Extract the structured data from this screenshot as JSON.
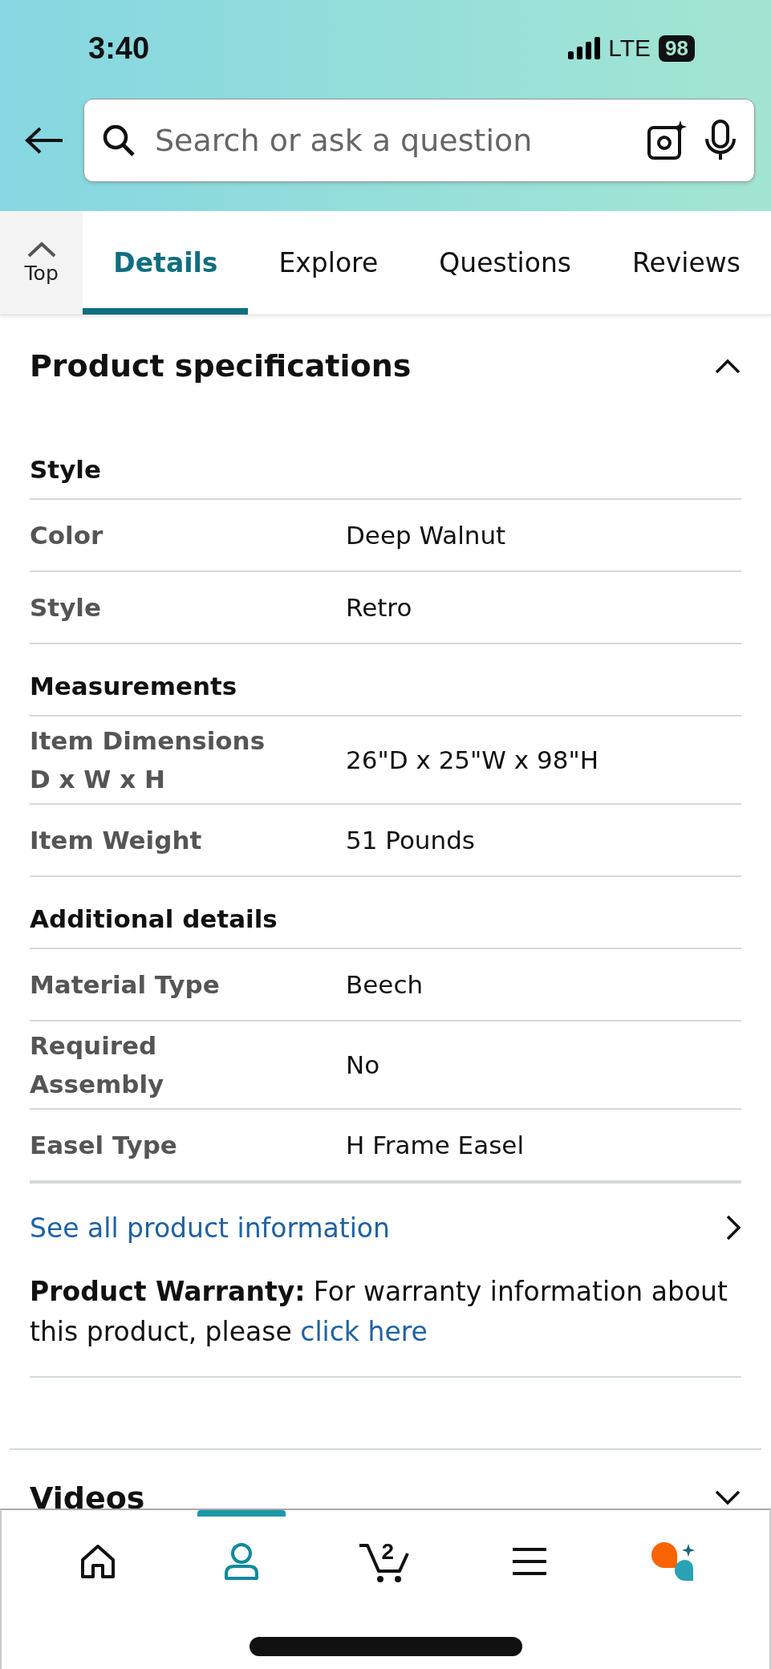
{
  "status_bar": {
    "time": "3:40",
    "network": "LTE",
    "battery": "98"
  },
  "search": {
    "placeholder": "Search or ask a question"
  },
  "tabs": [
    {
      "kind": "top",
      "label": "Top",
      "selected": false
    },
    {
      "kind": "tab",
      "label": "Details",
      "selected": true
    },
    {
      "kind": "tab",
      "label": "Explore",
      "selected": false
    },
    {
      "kind": "tab",
      "label": "Questions",
      "selected": false
    },
    {
      "kind": "tab",
      "label": "Reviews",
      "selected": false
    }
  ],
  "specifications": {
    "title": "Product specifications",
    "expanded": true,
    "groups": [
      {
        "heading": "Style",
        "rows": [
          {
            "label": "Color",
            "value": "Deep Walnut"
          },
          {
            "label": "Style",
            "value": "Retro"
          }
        ]
      },
      {
        "heading": "Measurements",
        "rows": [
          {
            "label": "Item Dimensions D x W x H",
            "value": "26\"D x 25\"W x 98\"H"
          },
          {
            "label": "Item Weight",
            "value": "51 Pounds"
          }
        ]
      },
      {
        "heading": "Additional details",
        "rows": [
          {
            "label": "Material Type",
            "value": "Beech"
          },
          {
            "label": "Required Assembly",
            "value": "No"
          },
          {
            "label": "Easel Type",
            "value": "H Frame Easel"
          }
        ]
      }
    ],
    "see_all_link": "See all product information",
    "warranty": {
      "text": "**Product Warranty:** For warranty information about this product, please ",
      "link": "click here"
    }
  },
  "videos": {
    "title": "Videos",
    "expanded": false
  },
  "bottom_nav": [
    {
      "kind": "home",
      "selected": false
    },
    {
      "kind": "account",
      "selected": true
    },
    {
      "kind": "cart",
      "count": "2",
      "selected": false
    },
    {
      "kind": "menu",
      "selected": false
    },
    {
      "kind": "assistant",
      "selected": false
    }
  ]
}
